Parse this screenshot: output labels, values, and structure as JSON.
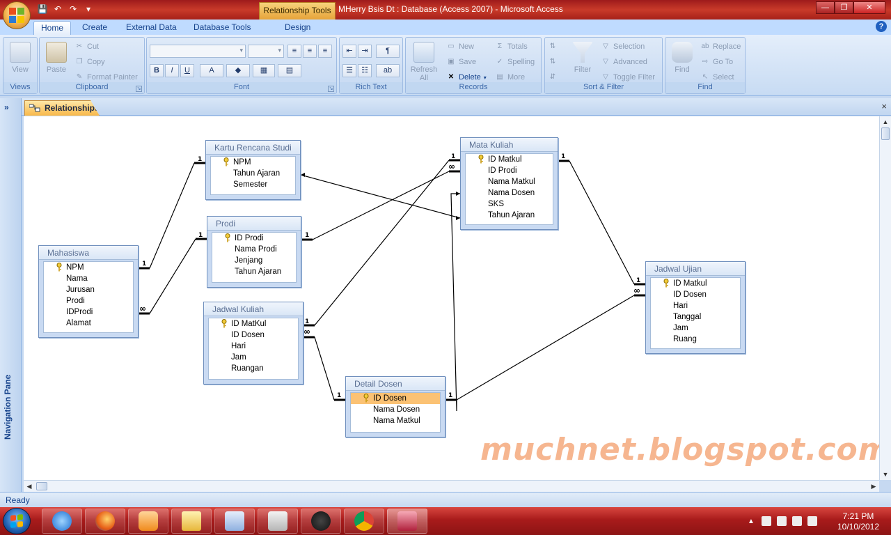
{
  "window": {
    "context_tab": "Relationship Tools",
    "title": "MHerry Bsis Dt : Database (Access 2007)  -  Microsoft Access"
  },
  "ribbon_tabs": [
    "Home",
    "Create",
    "External Data",
    "Database Tools",
    "Design"
  ],
  "ribbon": {
    "views": {
      "view": "View",
      "label": "Views"
    },
    "clipboard": {
      "paste": "Paste",
      "cut": "Cut",
      "copy": "Copy",
      "format_painter": "Format Painter",
      "label": "Clipboard"
    },
    "font": {
      "label": "Font",
      "bold": "B",
      "italic": "I",
      "underline": "U",
      "font_color": "A"
    },
    "rich_text": {
      "label": "Rich Text"
    },
    "records": {
      "refresh": "Refresh All",
      "new": "New",
      "save": "Save",
      "delete": "Delete",
      "totals": "Totals",
      "spelling": "Spelling",
      "more": "More",
      "label": "Records"
    },
    "sort_filter": {
      "filter": "Filter",
      "selection": "Selection",
      "advanced": "Advanced",
      "toggle_filter": "Toggle Filter",
      "label": "Sort & Filter"
    },
    "find": {
      "find": "Find",
      "replace": "Replace",
      "go_to": "Go To",
      "select": "Select",
      "label": "Find"
    }
  },
  "nav_pane": {
    "label": "Navigation Pane",
    "toggle": "»"
  },
  "document_tab": {
    "label": "Relationships",
    "close": "×"
  },
  "tables": [
    {
      "name": "Kartu Rencana Studi",
      "fields": [
        {
          "n": "NPM",
          "key": true
        },
        {
          "n": "Tahun Ajaran"
        },
        {
          "n": "Semester"
        }
      ]
    },
    {
      "name": "Prodi",
      "fields": [
        {
          "n": "ID Prodi",
          "key": true
        },
        {
          "n": "Nama Prodi"
        },
        {
          "n": "Jenjang"
        },
        {
          "n": "Tahun Ajaran"
        }
      ]
    },
    {
      "name": "Mahasiswa",
      "fields": [
        {
          "n": "NPM",
          "key": true
        },
        {
          "n": "Nama"
        },
        {
          "n": "Jurusan"
        },
        {
          "n": "Prodi"
        },
        {
          "n": "IDProdi"
        },
        {
          "n": "Alamat"
        }
      ]
    },
    {
      "name": "Jadwal Kuliah",
      "fields": [
        {
          "n": "ID MatKul",
          "key": true
        },
        {
          "n": "ID Dosen"
        },
        {
          "n": "Hari"
        },
        {
          "n": "Jam"
        },
        {
          "n": "Ruangan"
        }
      ]
    },
    {
      "name": "Mata Kuliah",
      "fields": [
        {
          "n": "ID Matkul",
          "key": true
        },
        {
          "n": "ID Prodi"
        },
        {
          "n": "Nama Matkul"
        },
        {
          "n": "Nama Dosen"
        },
        {
          "n": "SKS"
        },
        {
          "n": "Tahun Ajaran"
        }
      ]
    },
    {
      "name": "Detail Dosen",
      "fields": [
        {
          "n": "ID Dosen",
          "key": true,
          "selected": true
        },
        {
          "n": "Nama Dosen"
        },
        {
          "n": "Nama Matkul"
        }
      ]
    },
    {
      "name": "Jadwal Ujian",
      "fields": [
        {
          "n": "ID Matkul",
          "key": true
        },
        {
          "n": "ID Dosen"
        },
        {
          "n": "Hari"
        },
        {
          "n": "Tanggal"
        },
        {
          "n": "Jam"
        },
        {
          "n": "Ruang"
        }
      ]
    }
  ],
  "relationship_labels": {
    "one": "1",
    "many": "∞"
  },
  "watermark": "muchnet.blogspot.com",
  "status": {
    "text": "Ready"
  },
  "clock": {
    "time": "7:21 PM",
    "date": "10/10/2012"
  }
}
